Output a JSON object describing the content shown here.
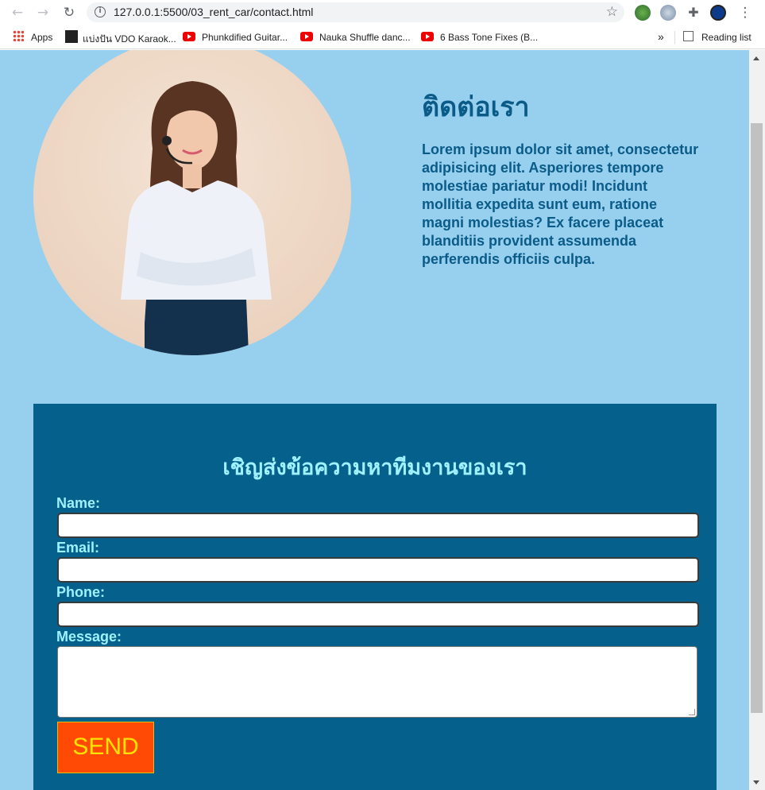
{
  "browser": {
    "url": "127.0.0.1:5500/03_rent_car/contact.html",
    "bookmarks": [
      {
        "label": "Apps"
      },
      {
        "label": "แบ่งปัน VDO Karaok..."
      },
      {
        "label": "Phunkdified Guitar..."
      },
      {
        "label": "Nauka Shuffle danc..."
      },
      {
        "label": "6 Bass Tone Fixes (B..."
      }
    ],
    "more": "»",
    "reading_list": "Reading list"
  },
  "hero": {
    "title": "ติดต่อเรา",
    "text": "Lorem ipsum dolor sit amet, consectetur adipisicing elit. Asperiores tempore molestiae pariatur modi! Incidunt mollitia expedita sunt eum, ratione magni molestias? Ex facere placeat blanditiis provident assumenda perferendis officiis culpa."
  },
  "form": {
    "title": "เชิญส่งข้อความหาทีมงานของเรา",
    "name_label": "Name:",
    "email_label": "Email:",
    "phone_label": "Phone:",
    "message_label": "Message:",
    "send_label": "SEND"
  },
  "colors": {
    "page_bg": "#97d0ef",
    "form_bg": "#05608b",
    "label": "#9ff1ff",
    "title": "#0b5b88",
    "button_bg": "#fe4a05",
    "button_text": "#ffe300"
  }
}
